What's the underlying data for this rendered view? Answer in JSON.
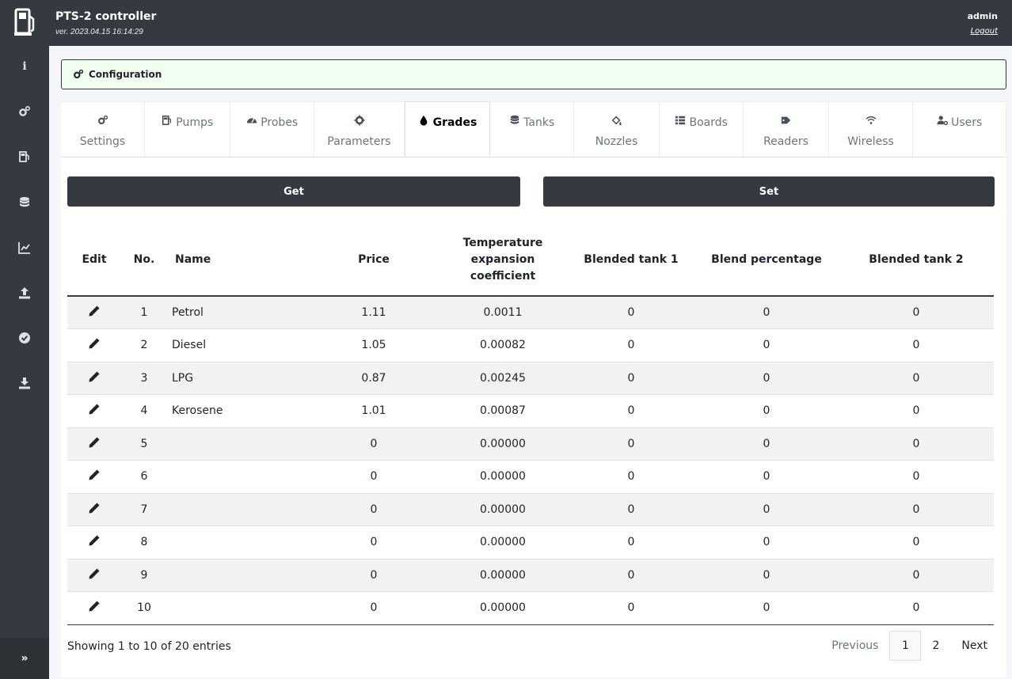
{
  "header": {
    "title": "PTS-2 controller",
    "version": "ver. 2023.04.15 16:14:29",
    "user": "admin",
    "logout": "Logout"
  },
  "sidebar": {
    "items": [
      "info-icon",
      "gears-icon",
      "pump-icon",
      "database-icon",
      "chart-icon",
      "upload-icon",
      "check-circle-icon",
      "download-icon"
    ],
    "info_glyph": "i",
    "toggle": "»"
  },
  "config": {
    "title": "Configuration"
  },
  "tabs": [
    {
      "line1": "",
      "line2": "Settings",
      "icon": "gears-icon",
      "active": false
    },
    {
      "line1": "Pumps",
      "line2": "",
      "icon": "pump-icon",
      "active": false
    },
    {
      "line1": "Probes",
      "line2": "",
      "icon": "gauge-icon",
      "active": false
    },
    {
      "line1": "",
      "line2": "Parameters",
      "icon": "gear-icon",
      "active": false
    },
    {
      "line1": "Grades",
      "line2": "",
      "icon": "drop-icon",
      "active": true
    },
    {
      "line1": "Tanks",
      "line2": "",
      "icon": "database-icon",
      "active": false
    },
    {
      "line1": "",
      "line2": "Nozzles",
      "icon": "fill-icon",
      "active": false
    },
    {
      "line1": "Boards",
      "line2": "",
      "icon": "list-icon",
      "active": false
    },
    {
      "line1": "",
      "line2": "Readers",
      "icon": "tag-icon",
      "active": false
    },
    {
      "line1": "",
      "line2": "Wireless",
      "icon": "wifi-icon",
      "active": false
    },
    {
      "line1": "Users",
      "line2": "",
      "icon": "user-cog-icon",
      "active": false
    }
  ],
  "actions": {
    "get": "Get",
    "set": "Set"
  },
  "table": {
    "columns": {
      "edit": "Edit",
      "no": "No.",
      "name": "Name",
      "price": "Price",
      "temp_l1": "Temperature",
      "temp_l2": "expansion",
      "temp_l3": "coefficient",
      "blended1": "Blended tank 1",
      "blend_pct": "Blend percentage",
      "blended2": "Blended tank 2"
    },
    "rows": [
      {
        "no": "1",
        "name": "Petrol",
        "price": "1.11",
        "coef": "0.0011",
        "b1": "0",
        "pct": "0",
        "b2": "0"
      },
      {
        "no": "2",
        "name": "Diesel",
        "price": "1.05",
        "coef": "0.00082",
        "b1": "0",
        "pct": "0",
        "b2": "0"
      },
      {
        "no": "3",
        "name": "LPG",
        "price": "0.87",
        "coef": "0.00245",
        "b1": "0",
        "pct": "0",
        "b2": "0"
      },
      {
        "no": "4",
        "name": "Kerosene",
        "price": "1.01",
        "coef": "0.00087",
        "b1": "0",
        "pct": "0",
        "b2": "0"
      },
      {
        "no": "5",
        "name": "",
        "price": "0",
        "coef": "0.00000",
        "b1": "0",
        "pct": "0",
        "b2": "0"
      },
      {
        "no": "6",
        "name": "",
        "price": "0",
        "coef": "0.00000",
        "b1": "0",
        "pct": "0",
        "b2": "0"
      },
      {
        "no": "7",
        "name": "",
        "price": "0",
        "coef": "0.00000",
        "b1": "0",
        "pct": "0",
        "b2": "0"
      },
      {
        "no": "8",
        "name": "",
        "price": "0",
        "coef": "0.00000",
        "b1": "0",
        "pct": "0",
        "b2": "0"
      },
      {
        "no": "9",
        "name": "",
        "price": "0",
        "coef": "0.00000",
        "b1": "0",
        "pct": "0",
        "b2": "0"
      },
      {
        "no": "10",
        "name": "",
        "price": "0",
        "coef": "0.00000",
        "b1": "0",
        "pct": "0",
        "b2": "0"
      }
    ]
  },
  "footer": {
    "info": "Showing 1 to 10 of 20 entries",
    "previous": "Previous",
    "page1": "1",
    "page2": "2",
    "next": "Next"
  }
}
